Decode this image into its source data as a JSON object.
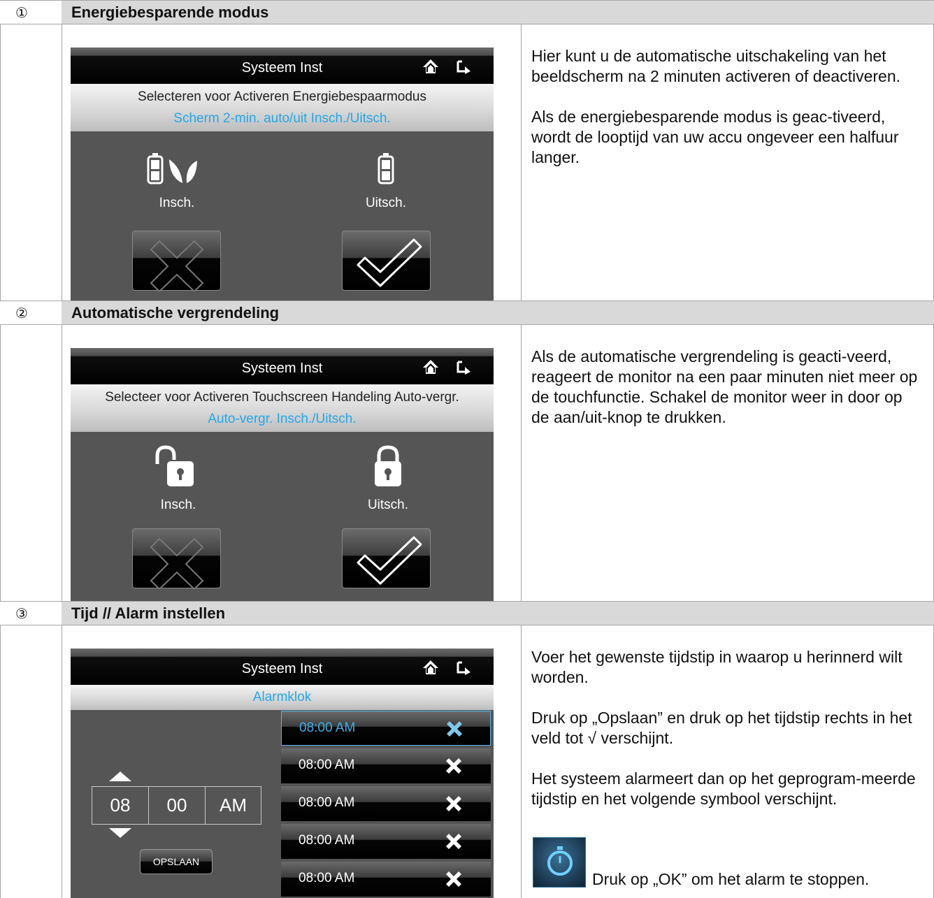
{
  "sections": [
    {
      "num": "①",
      "title": "Energiebesparende modus",
      "screen": {
        "title": "Systeem Inst",
        "line1": "Selecteren voor Activeren Energiebespaarmodus",
        "line2": "Scherm 2-min. auto/uit Insch./Uitsch.",
        "opt_on": "Insch.",
        "opt_off": "Uitsch."
      },
      "desc": [
        "Hier kunt u de automatische uitschakeling van het beeldscherm na 2 minuten activeren of deactiveren.",
        "Als de energiebesparende modus is geac-tiveerd, wordt de looptijd van uw accu ongeveer een halfuur langer."
      ]
    },
    {
      "num": "②",
      "title": "Automatische vergrendeling",
      "screen": {
        "title": "Systeem Inst",
        "line1": "Selecteer voor Activeren Touchscreen Handeling Auto-vergr.",
        "line2": "Auto-vergr. Insch./Uitsch.",
        "opt_on": "Insch.",
        "opt_off": "Uitsch."
      },
      "desc": [
        "Als de automatische vergrendeling is geacti-veerd, reageert de monitor na een paar minuten niet meer op de touchfunctie. Schakel de monitor weer in door op de aan/uit-knop te drukken."
      ]
    },
    {
      "num": "③",
      "title": "Tijd // Alarm instellen",
      "screen": {
        "title": "Systeem Inst",
        "subtitle": "Alarmklok",
        "hour": "08",
        "minute": "00",
        "ampm": "AM",
        "save": "OPSLAAN",
        "alarms": [
          "08:00 AM",
          "08:00 AM",
          "08:00 AM",
          "08:00 AM",
          "08:00 AM"
        ]
      },
      "desc": [
        "Voer het gewenste tijdstip in waarop u herinnerd wilt worden.",
        "Druk op „Opslaan” en druk op het tijdstip rechts in het veld tot √ verschijnt.",
        "Het systeem alarmeert dan op het geprogram-meerde tijdstip en het volgende symbool verschijnt."
      ],
      "desc_last": "Druk op „OK” om het alarm te stoppen."
    }
  ],
  "colors": {
    "header_bg": "#d9d9d9",
    "accent_blue": "#23a8e8",
    "screen_bg": "#555555"
  },
  "icons": [
    "home-icon",
    "back-icon",
    "battery-leaf-icon",
    "battery-icon",
    "unlock-icon",
    "lock-icon",
    "cancel-x-icon",
    "confirm-check-icon",
    "delete-x-icon",
    "stopwatch-icon"
  ]
}
